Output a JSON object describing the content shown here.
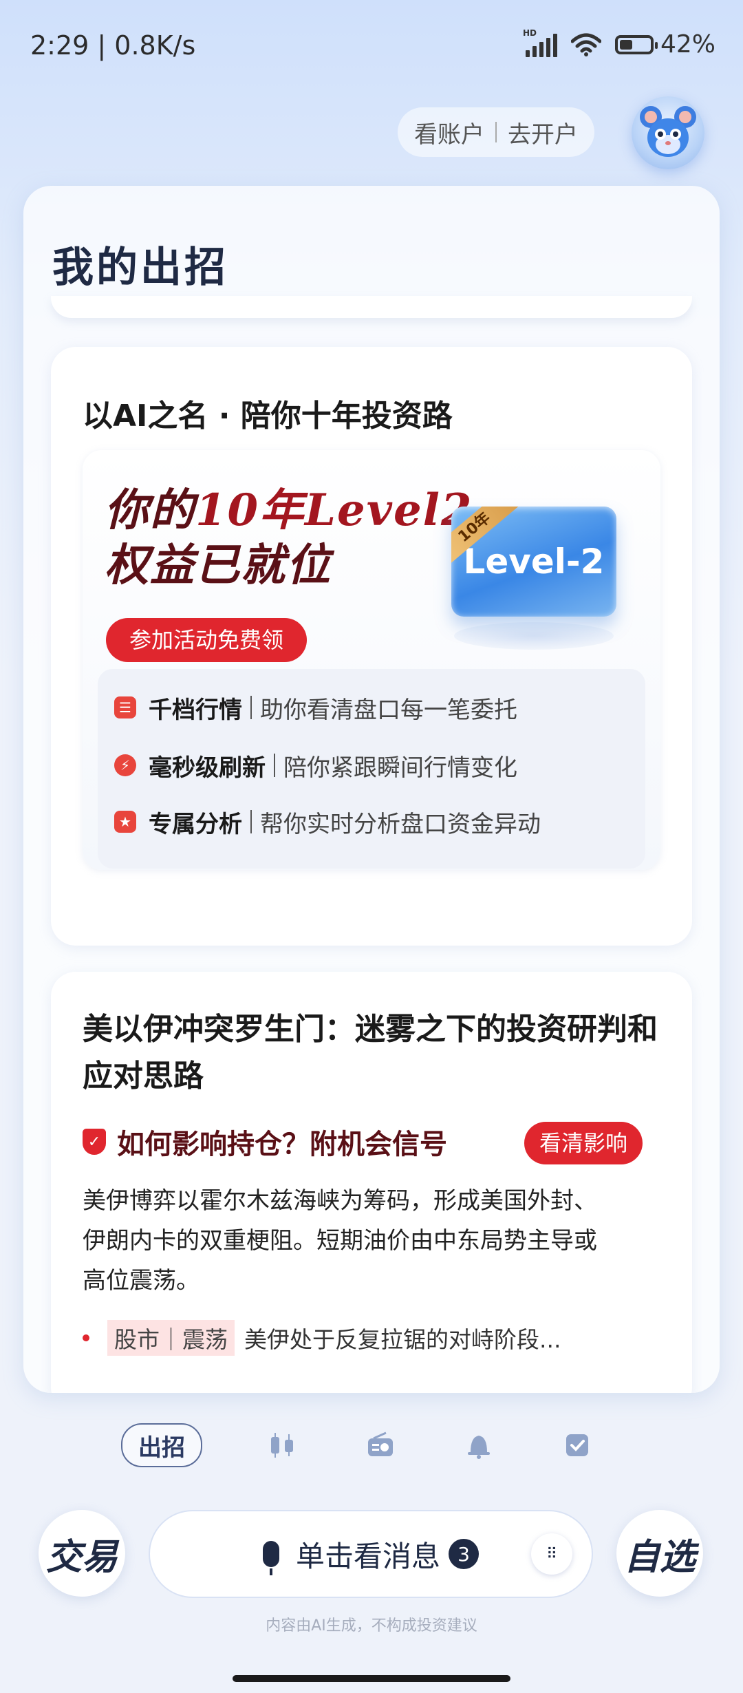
{
  "status_bar": {
    "time": "2:29 | 0.8K/s",
    "network_label": "HD",
    "battery": "42%",
    "battery_level": 0.42
  },
  "header": {
    "view_account": "看账户",
    "open_account": "去开户"
  },
  "panel": {
    "title": "我的出招"
  },
  "card1": {
    "heading": "以AI之名 · 陪你十年投资路",
    "promo_line1_a": "你的",
    "promo_line1_b": "10年Level2",
    "promo_line2": "权益已就位",
    "promo_button": "参加活动免费领",
    "badge_tag": "10年",
    "badge_label": "Level-2",
    "features": [
      {
        "icon": "list-icon",
        "title": "千档行情",
        "desc": "助你看清盘口每一笔委托"
      },
      {
        "icon": "lightning-icon",
        "title": "毫秒级刷新",
        "desc": "陪你紧跟瞬间行情变化"
      },
      {
        "icon": "star-shield-icon",
        "title": "专属分析",
        "desc": "帮你实时分析盘口资金异动"
      }
    ]
  },
  "card2": {
    "title": "美以伊冲突罗生门：迷雾之下的投资研判和应对思路",
    "subtitle": "如何影响持仓？附机会信号",
    "button": "看清影响",
    "body": "美伊博弈以霍尔木兹海峡为筹码，形成美国外封、伊朗内卡的双重梗阻。短期油价由中东局势主导或高位震荡。",
    "bullet_tag": "股市｜震荡",
    "bullet_text": "美伊处于反复拉锯的对峙阶段..."
  },
  "tabs": {
    "active": "出招",
    "icons": [
      "candlestick-icon",
      "radio-icon",
      "bell-icon",
      "checkbox-icon"
    ]
  },
  "bottom": {
    "trade": "交易",
    "watchlist": "自选",
    "message_label": "单击看消息",
    "message_count": "3",
    "disclaimer": "内容由AI生成，不构成投资建议"
  },
  "colors": {
    "accent_red": "#e0262e",
    "navy": "#1f2a44"
  }
}
